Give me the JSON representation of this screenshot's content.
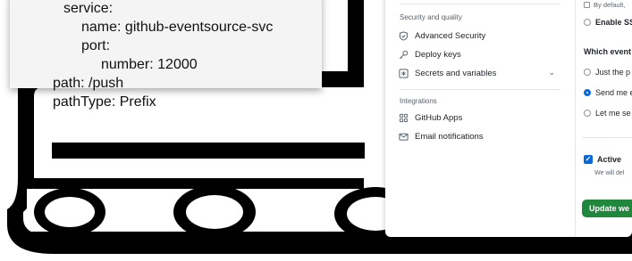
{
  "yaml_snippet": {
    "lines": [
      "service:",
      "name: github-eventsource-svc",
      "port:",
      "number: 12000",
      "path: /push",
      "pathType: Prefix"
    ]
  },
  "sidebar": {
    "security_section_label": "Security and quality",
    "security_items": [
      {
        "label": "Advanced Security",
        "icon": "shield-check-icon"
      },
      {
        "label": "Deploy keys",
        "icon": "key-icon"
      },
      {
        "label": "Secrets and variables",
        "icon": "asterisk-square-icon"
      }
    ],
    "integrations_section_label": "Integrations",
    "integration_items": [
      {
        "label": "GitHub Apps",
        "icon": "apps-grid-icon"
      },
      {
        "label": "Email notifications",
        "icon": "mail-icon"
      }
    ]
  },
  "webhook_form": {
    "default_note": "By default,",
    "ssl_option": "Enable SS",
    "events_heading": "Which event",
    "event_options": [
      "Just the p",
      "Send me e",
      "Let me se"
    ],
    "selected_event_index": 1,
    "active_label": "Active",
    "active_checked": true,
    "active_note": "We will del",
    "update_button": "Update we"
  },
  "colors": {
    "accent": "#0969da",
    "button_green": "#1f883d"
  }
}
